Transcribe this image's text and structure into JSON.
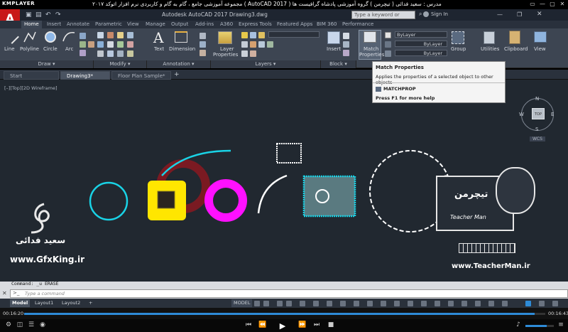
{
  "player": {
    "logo": "KMPLAYER",
    "title": "مجموعه آموزشی جامع ، گام به گام و کاربردی نرم افزار  اتوکد ۲۰۱۷ ( AutoCAD 2017 )   مدرس : سعید فدائی ( تیچرمن ) گروه آموزشی پادشاه گرافیست ها",
    "window_buttons": [
      "▭",
      "—",
      "▢",
      "✕"
    ],
    "time_elapsed": "00:16:20",
    "time_total": "00:16:43",
    "progress": 0.98,
    "controls": [
      "⏮",
      "⏪",
      "▶",
      "⏩",
      "⏭",
      "■"
    ],
    "volume": 0.75
  },
  "app": {
    "logo_letter": "A",
    "title": "Autodesk AutoCAD 2017    Drawing3.dwg",
    "search_placeholder": "Type a keyword or phrase",
    "sign_in": "Sign In",
    "qat_icons": [
      "folder-icon",
      "save-icon",
      "undo-icon",
      "redo-icon"
    ]
  },
  "ribbon": {
    "tabs": [
      "Home",
      "Insert",
      "Annotate",
      "Parametric",
      "View",
      "Manage",
      "Output",
      "Add-ins",
      "A360",
      "Express Tools",
      "Featured Apps",
      "BIM 360",
      "Performance"
    ],
    "active_tab": "Home",
    "draw_buttons": [
      "Line",
      "Polyline",
      "Circle",
      "Arc"
    ],
    "annotation_buttons": [
      "Text",
      "Dimension"
    ],
    "layer_button": [
      "Layer",
      "Properties"
    ],
    "block_button": "Insert",
    "match_properties": [
      "Match",
      "Properties"
    ],
    "property_dropdowns": [
      "ByLayer",
      "ByLayer",
      "ByLayer"
    ],
    "right_buttons": [
      "Group",
      "Utilities",
      "Clipboard",
      "View"
    ],
    "panels": [
      "Draw",
      "Modify",
      "Annotation",
      "Layers",
      "Block"
    ]
  },
  "tooltip": {
    "title": "Match Properties",
    "description": "Applies the properties of a selected object to other objects",
    "command": "MATCHPROP",
    "help": "Press F1 for more help"
  },
  "documents": {
    "tabs": [
      "Start",
      "Drawing3*",
      "Floor Plan Sample*"
    ],
    "active": "Drawing3*",
    "add": "+"
  },
  "viewport": {
    "label": "[–][Top][2D Wireframe]",
    "compass": {
      "n": "N",
      "e": "E",
      "s": "S",
      "w": "W",
      "top": "TOP",
      "wcs": "WCS"
    }
  },
  "watermarks": {
    "left_name": "سعید فدائی",
    "left_url": "www.GfxKing.ir",
    "right_url": "www.TeacherMan.ir",
    "right_logo_fa": "تیچرمن",
    "right_logo_en": "Teacher Man"
  },
  "command": {
    "history": "Command:  _u  ERASE",
    "placeholder": "Type  a  command"
  },
  "status": {
    "tabs": [
      "Model",
      "Layout1",
      "Layout2"
    ],
    "active": "Model",
    "add": "+",
    "model_label": "MODEL"
  },
  "colors": {
    "canvas": "#212830",
    "cyan": "#19d3e6",
    "yellow": "#ffe600",
    "magenta": "#ff10ff",
    "dark_red": "#7a1a22",
    "white": "#ffffff",
    "accent_blue": "#2e8bd7"
  }
}
